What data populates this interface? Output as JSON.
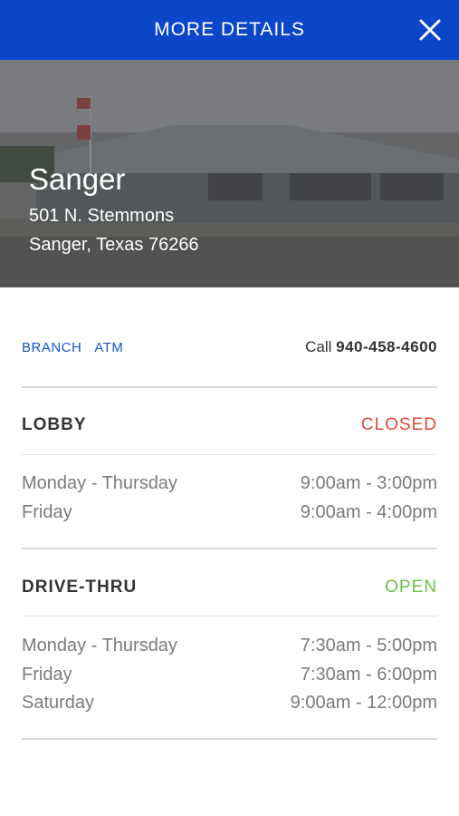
{
  "header": {
    "title": "MORE DETAILS"
  },
  "branch": {
    "name": "Sanger",
    "address_line1": "501 N. Stemmons",
    "address_line2": "Sanger, Texas 76266"
  },
  "links": {
    "branch": "BRANCH",
    "atm": "ATM"
  },
  "call": {
    "prefix": "Call",
    "number": "940-458-4600"
  },
  "lobby": {
    "title": "LOBBY",
    "status": "CLOSED",
    "hours": [
      {
        "days": "Monday - Thursday",
        "time": "9:00am - 3:00pm"
      },
      {
        "days": "Friday",
        "time": "9:00am - 4:00pm"
      }
    ]
  },
  "drive_thru": {
    "title": "DRIVE-THRU",
    "status": "OPEN",
    "hours": [
      {
        "days": "Monday - Thursday",
        "time": "7:30am - 5:00pm"
      },
      {
        "days": "Friday",
        "time": "7:30am - 6:00pm"
      },
      {
        "days": "Saturday",
        "time": "9:00am - 12:00pm"
      }
    ]
  },
  "colors": {
    "header_bg": "#0b45c8",
    "link": "#1a55c4",
    "closed": "#e2473b",
    "open": "#6cc04a"
  }
}
